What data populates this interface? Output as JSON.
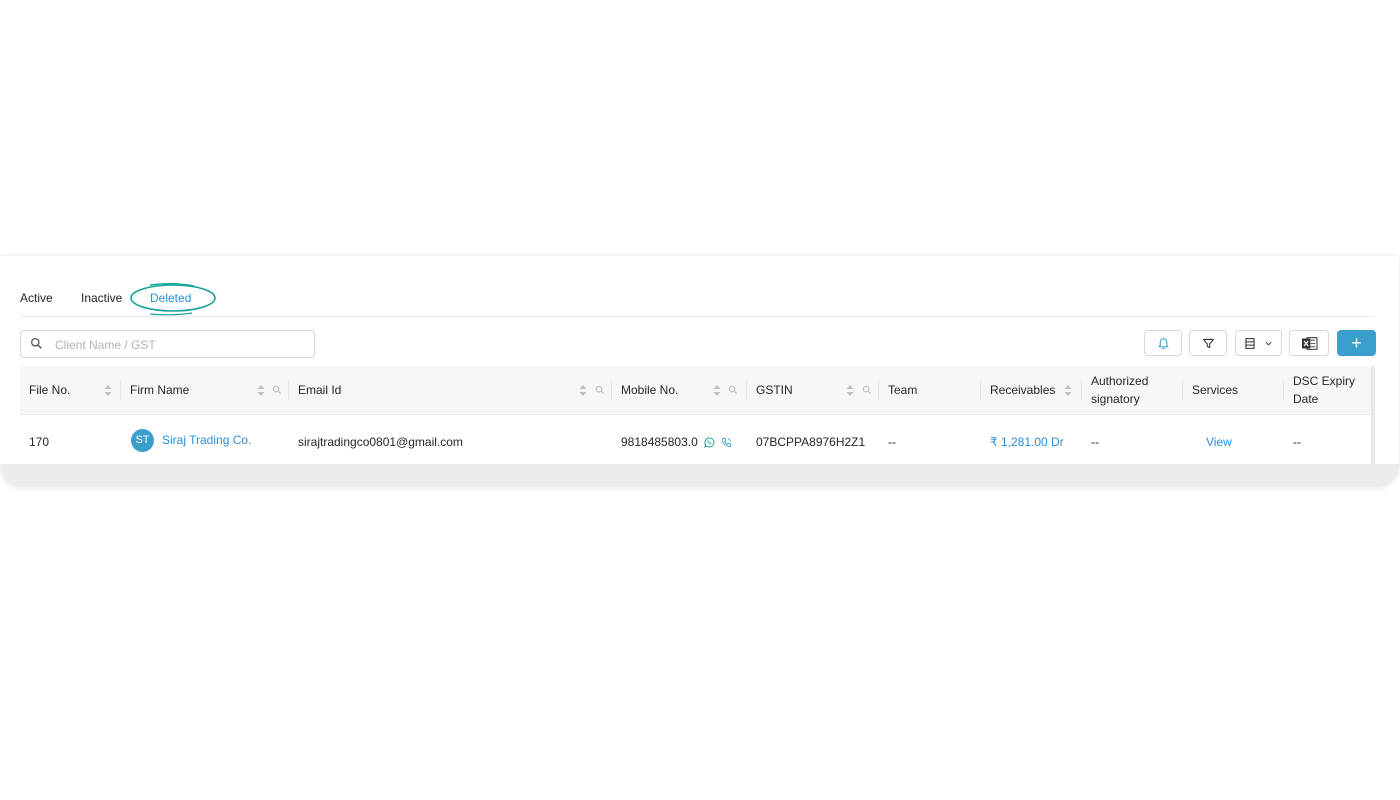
{
  "tabs": [
    {
      "label": "Active"
    },
    {
      "label": "Inactive"
    },
    {
      "label": "Deleted",
      "active": true
    }
  ],
  "search": {
    "placeholder": "Client Name / GST",
    "value": ""
  },
  "toolbar": {
    "add_label": "+"
  },
  "table": {
    "columns": [
      {
        "label": "File No."
      },
      {
        "label": "Firm Name"
      },
      {
        "label": "Email Id"
      },
      {
        "label": "Mobile No."
      },
      {
        "label": "GSTIN"
      },
      {
        "label": "Team"
      },
      {
        "label": "Receivables"
      },
      {
        "label": "Authorized signatory"
      },
      {
        "label": "Services"
      },
      {
        "label": "DSC Expiry Date"
      }
    ],
    "rows": [
      {
        "file_no": "170",
        "avatar_initials": "ST",
        "firm_name": "Siraj Trading Co.",
        "email": "sirajtradingco0801@gmail.com",
        "mobile": "9818485803.0",
        "gstin": "07BCPPA8976H2Z1",
        "team": "--",
        "receivables": "₹ 1,281.00 Dr",
        "authorized_signatory": "--",
        "services": "View",
        "dsc_expiry": "--"
      }
    ]
  },
  "colors": {
    "accent": "#3a9fcd",
    "link": "#2b8fd6",
    "highlight": "#1aa59a"
  }
}
